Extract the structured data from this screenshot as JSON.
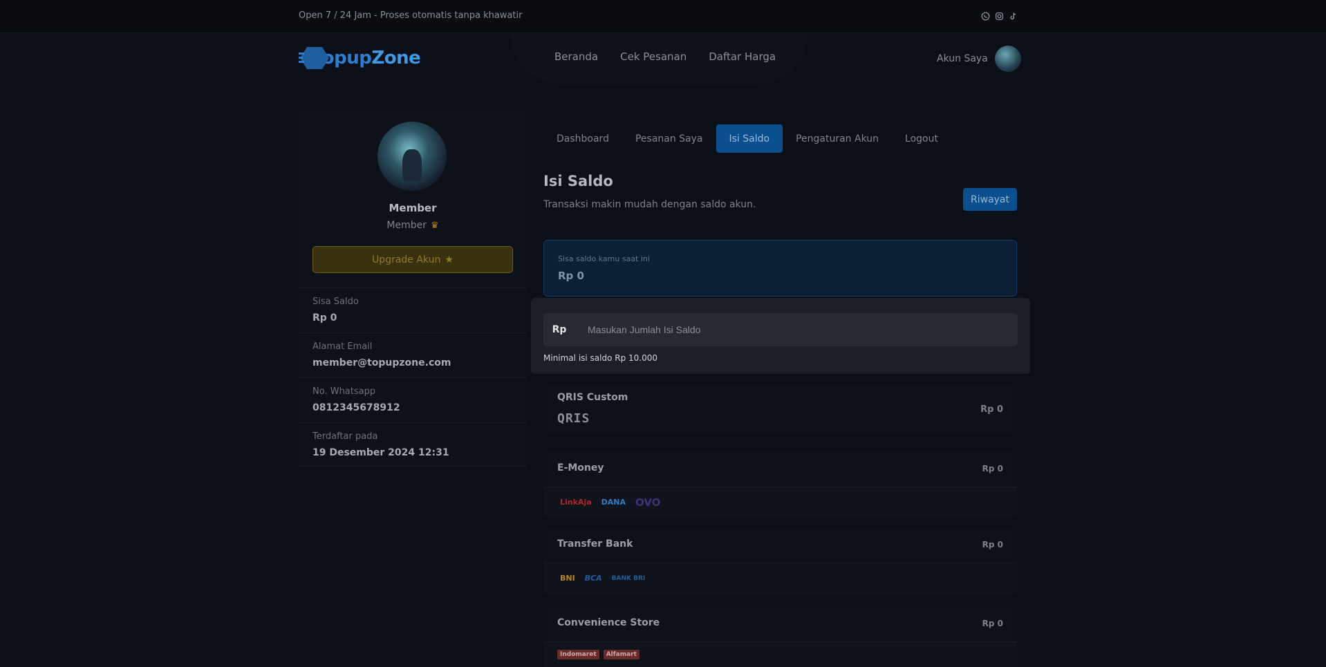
{
  "topbar": {
    "promo": "Open 7 / 24 Jam - Proses otomatis tanpa khawatir",
    "socials": [
      "whatsapp-icon",
      "instagram-icon",
      "tiktok-icon"
    ]
  },
  "brand": {
    "name_part1": "Topup",
    "name_part2": "Zone"
  },
  "nav": {
    "home": "Beranda",
    "check_order": "Cek Pesanan",
    "price_list": "Daftar Harga"
  },
  "account": {
    "label": "Akun Saya"
  },
  "profile": {
    "name": "Member",
    "tier": "Member",
    "upgrade_label": "Upgrade Akun",
    "info": [
      {
        "label": "Sisa Saldo",
        "value": "Rp 0"
      },
      {
        "label": "Alamat Email",
        "value": "member@topupzone.com"
      },
      {
        "label": "No. Whatsapp",
        "value": "0812345678912"
      },
      {
        "label": "Terdaftar pada",
        "value": "19 Desember 2024 12:31"
      }
    ]
  },
  "tabs": [
    {
      "label": "Dashboard",
      "active": false
    },
    {
      "label": "Pesanan Saya",
      "active": false
    },
    {
      "label": "Isi Saldo",
      "active": true
    },
    {
      "label": "Pengaturan Akun",
      "active": false
    },
    {
      "label": "Logout",
      "active": false
    }
  ],
  "page": {
    "title": "Isi Saldo",
    "subtitle": "Transaksi makin mudah dengan saldo akun.",
    "history_button": "Riwayat"
  },
  "balance": {
    "label": "Sisa saldo kamu saat ini",
    "value": "Rp 0"
  },
  "topup": {
    "currency_prefix": "Rp",
    "placeholder": "Masukan Jumlah Isi Saldo",
    "value": "",
    "hint": "Minimal isi saldo Rp 10.000"
  },
  "payment_methods": [
    {
      "title": "QRIS Custom",
      "price": "Rp 0",
      "logo_text": "QRIS"
    },
    {
      "title": "E-Money",
      "price": "Rp 0",
      "logos": [
        "LinkAja",
        "DANA",
        "OVO"
      ]
    },
    {
      "title": "Transfer Bank",
      "price": "Rp 0",
      "logos": [
        "BNI",
        "BCA",
        "BANK BRI"
      ]
    },
    {
      "title": "Convenience Store",
      "price": "Rp 0",
      "logos": [
        "Indomaret",
        "Alfamart"
      ]
    }
  ],
  "colors": {
    "accent": "#0c4f8f",
    "warning": "#6f5c18",
    "background": "#0b0f17"
  }
}
